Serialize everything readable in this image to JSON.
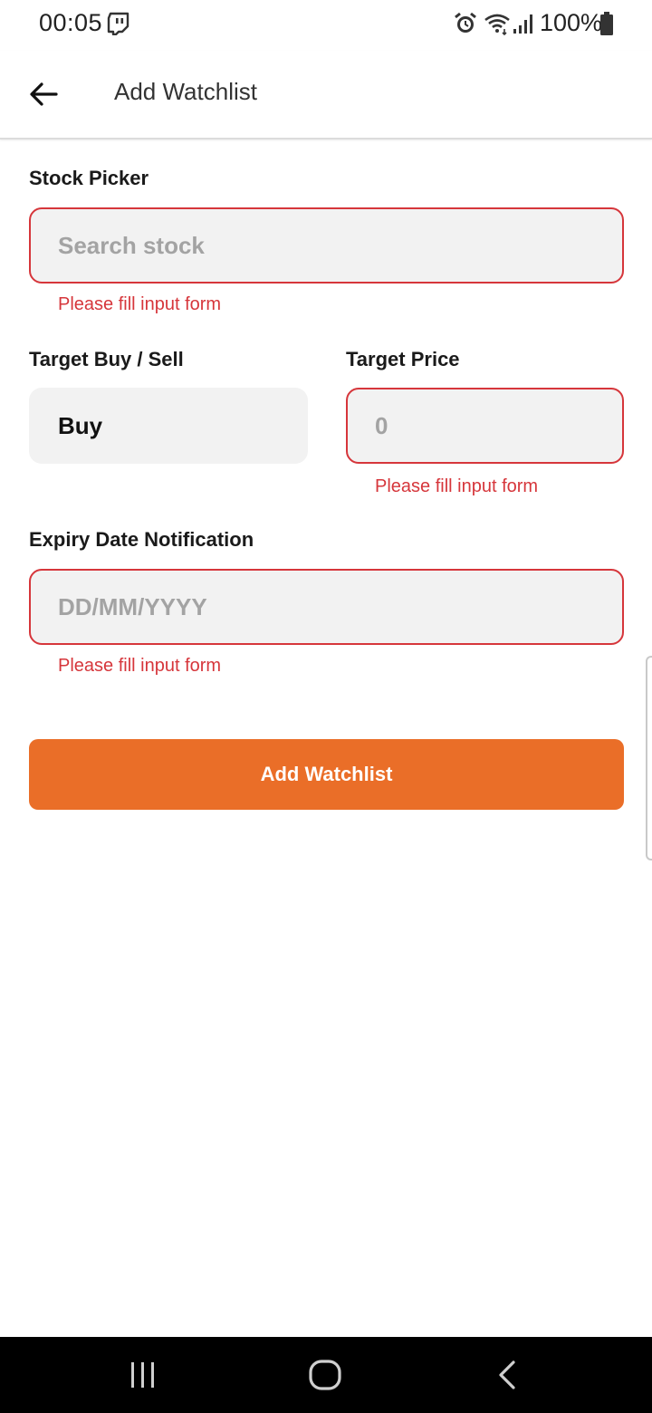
{
  "status_bar": {
    "time": "00:05",
    "battery": "100%",
    "icons": [
      "twitch-icon",
      "alarm-icon",
      "wifi-icon",
      "signal-icon",
      "battery-icon"
    ]
  },
  "app_bar": {
    "title": "Add Watchlist",
    "back_icon": "arrow-left-icon"
  },
  "form": {
    "stock_picker": {
      "label": "Stock Picker",
      "placeholder": "Search stock",
      "error": "Please fill input form"
    },
    "target_buy_sell": {
      "label": "Target Buy / Sell",
      "value": "Buy"
    },
    "target_price": {
      "label": "Target Price",
      "placeholder": "0",
      "error": "Please fill input form"
    },
    "expiry_date": {
      "label": "Expiry Date Notification",
      "placeholder": "DD/MM/YYYY",
      "error": "Please fill input form"
    },
    "submit_label": "Add Watchlist"
  },
  "colors": {
    "accent": "#ea6e28",
    "error": "#d6363b",
    "field_bg": "#f2f2f2"
  },
  "nav_bar": {
    "icons": [
      "recents-icon",
      "home-icon",
      "back-icon"
    ]
  }
}
